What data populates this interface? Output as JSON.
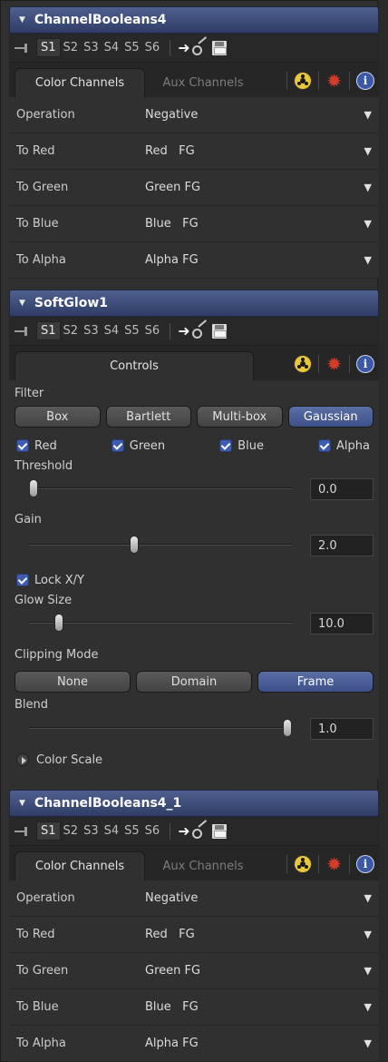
{
  "cb4": {
    "title": "ChannelBooleans4",
    "versions": [
      "S1",
      "S2",
      "S3",
      "S4",
      "S5",
      "S6"
    ],
    "tabs": [
      "Color Channels",
      "Aux Channels"
    ],
    "params": [
      {
        "label": "Operation",
        "value": "Negative"
      },
      {
        "label": "To Red",
        "value": "Red   FG"
      },
      {
        "label": "To Green",
        "value": "Green FG"
      },
      {
        "label": "To Blue",
        "value": "Blue   FG"
      },
      {
        "label": "To Alpha",
        "value": "Alpha FG"
      }
    ]
  },
  "sg": {
    "title": "SoftGlow1",
    "versions": [
      "S1",
      "S2",
      "S3",
      "S4",
      "S5",
      "S6"
    ],
    "tab": "Controls",
    "filter_label": "Filter",
    "filter_options": [
      "Box",
      "Bartlett",
      "Multi-box",
      "Gaussian"
    ],
    "filter_selected": "Gaussian",
    "channels": [
      "Red",
      "Green",
      "Blue",
      "Alpha"
    ],
    "threshold": {
      "label": "Threshold",
      "value": "0.0",
      "fraction": 0.0
    },
    "gain": {
      "label": "Gain",
      "value": "2.0",
      "fraction": 0.4
    },
    "lock_label": "Lock X/Y",
    "glow": {
      "label": "Glow Size",
      "value": "10.0",
      "fraction": 0.1
    },
    "clip_label": "Clipping Mode",
    "clip_options": [
      "None",
      "Domain",
      "Frame"
    ],
    "clip_selected": "Frame",
    "blend": {
      "label": "Blend",
      "value": "1.0",
      "fraction": 1.0
    },
    "color_scale": "Color Scale"
  },
  "cb41": {
    "title": "ChannelBooleans4_1",
    "versions": [
      "S1",
      "S2",
      "S3",
      "S4",
      "S5",
      "S6"
    ],
    "tabs": [
      "Color Channels",
      "Aux Channels"
    ],
    "params": [
      {
        "label": "Operation",
        "value": "Negative"
      },
      {
        "label": "To Red",
        "value": "Red   FG"
      },
      {
        "label": "To Green",
        "value": "Green FG"
      },
      {
        "label": "To Blue",
        "value": "Blue   FG"
      },
      {
        "label": "To Alpha",
        "value": "Alpha FG"
      }
    ]
  },
  "colors": {
    "header": "#3f4f80",
    "accent": "#3e5db0",
    "background": "#303030"
  }
}
